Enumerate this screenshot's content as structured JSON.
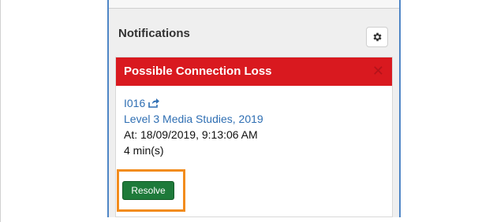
{
  "panel": {
    "title": "Notifications",
    "settings_icon": "gear-icon"
  },
  "notification": {
    "title": "Possible Connection Loss",
    "close_icon": "close-icon",
    "session_id": "I016",
    "share_icon": "share-icon",
    "course": "Level 3 Media Studies, 2019",
    "timestamp": "At: 18/09/2019, 9:13:06 AM",
    "duration": "4 min(s)",
    "resolve_label": "Resolve"
  },
  "colors": {
    "header_red": "#d9191f",
    "link_blue": "#2f6fb3",
    "resolve_green": "#1e7a3a",
    "highlight_orange": "#f28c1d"
  }
}
